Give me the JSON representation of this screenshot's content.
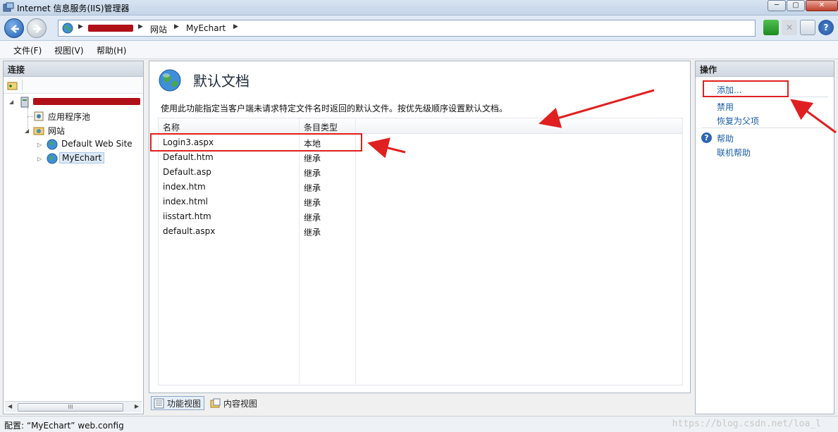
{
  "window": {
    "title": "Internet 信息服务(IIS)管理器",
    "buttons": {
      "minimize": "─",
      "maximize": "▢",
      "close": "✕"
    }
  },
  "address": {
    "crumbs": [
      "网站",
      "MyEchart"
    ]
  },
  "menu": {
    "file": "文件(F)",
    "view": "视图(V)",
    "help": "帮助(H)"
  },
  "connections": {
    "header": "连接",
    "tree": {
      "app_pools": "应用程序池",
      "sites": "网站",
      "default_site": "Default Web Site",
      "myechart": "MyEchart"
    },
    "scroll_thumb": "III"
  },
  "feature": {
    "title": "默认文档",
    "description": "使用此功能指定当客户端未请求特定文件名时返回的默认文件。按优先级顺序设置默认文档。",
    "columns": {
      "name": "名称",
      "entry_type": "条目类型"
    },
    "rows": [
      {
        "name": "Login3.aspx",
        "type": "本地"
      },
      {
        "name": "Default.htm",
        "type": "继承"
      },
      {
        "name": "Default.asp",
        "type": "继承"
      },
      {
        "name": "index.htm",
        "type": "继承"
      },
      {
        "name": "index.html",
        "type": "继承"
      },
      {
        "name": "iisstart.htm",
        "type": "继承"
      },
      {
        "name": "default.aspx",
        "type": "继承"
      }
    ]
  },
  "view_tabs": {
    "features_view": "功能视图",
    "content_view": "内容视图"
  },
  "actions": {
    "header": "操作",
    "add": "添加...",
    "disable": "禁用",
    "revert": "恢复为父项",
    "help": "帮助",
    "online_help": "联机帮助"
  },
  "status": {
    "text": "配置: “MyEchart” web.config",
    "watermark": "https://blog.csdn.net/loa_l"
  },
  "colors": {
    "annotation": "#e02020",
    "link": "#1c5da8"
  }
}
